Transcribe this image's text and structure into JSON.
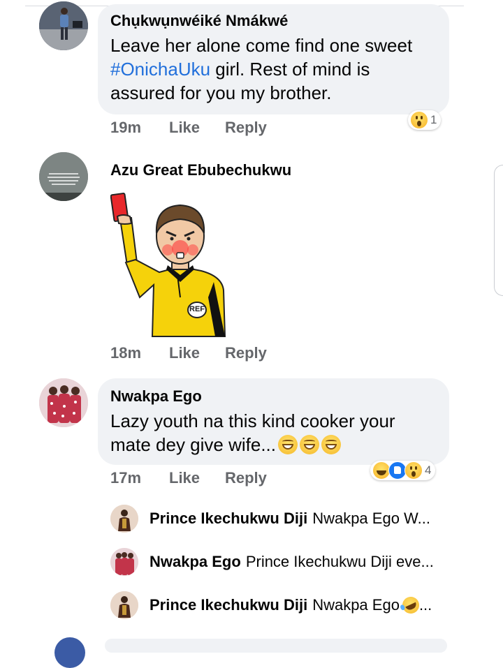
{
  "comments": [
    {
      "author": "Chụkwụnwéiké Nmákwé",
      "text_before": "Leave her alone come find one sweet ",
      "hashtag": "#OnichaUku",
      "text_after": " girl. Rest of mind is assured for you my brother.",
      "time": "19m",
      "like": "Like",
      "reply": "Reply",
      "reaction_count": "1",
      "reactions": [
        "wow"
      ]
    },
    {
      "author": "Azu Great Ebubechukwu",
      "sticker": "referee-red-card-sticker",
      "sticker_badge": "REF",
      "time": "18m",
      "like": "Like",
      "reply": "Reply"
    },
    {
      "author": "Nwakpa Ego",
      "text": "Lazy youth na this kind cooker your mate dey give wife...",
      "emoji": [
        "grinning-face",
        "grinning-face",
        "grinning-face"
      ],
      "time": "17m",
      "like": "Like",
      "reply": "Reply",
      "reaction_count": "4",
      "reactions": [
        "haha",
        "like",
        "wow"
      ]
    }
  ],
  "replies": [
    {
      "author": "Prince Ikechukwu Diji",
      "text": "Nwakpa Ego W..."
    },
    {
      "author": "Nwakpa Ego",
      "text": "Prince Ikechukwu Diji eve..."
    },
    {
      "author": "Prince Ikechukwu Diji",
      "text": "Nwakpa Ego",
      "emoji": "rolling-laughing-face",
      "ellipsis": "..."
    }
  ],
  "colors": {
    "bubble": "#f0f2f5",
    "hashtag": "#216fdb",
    "meta": "#65676b",
    "like_blue": "#1877f2",
    "referee_shirt": "#f5d20b",
    "red_card": "#e8282b"
  }
}
